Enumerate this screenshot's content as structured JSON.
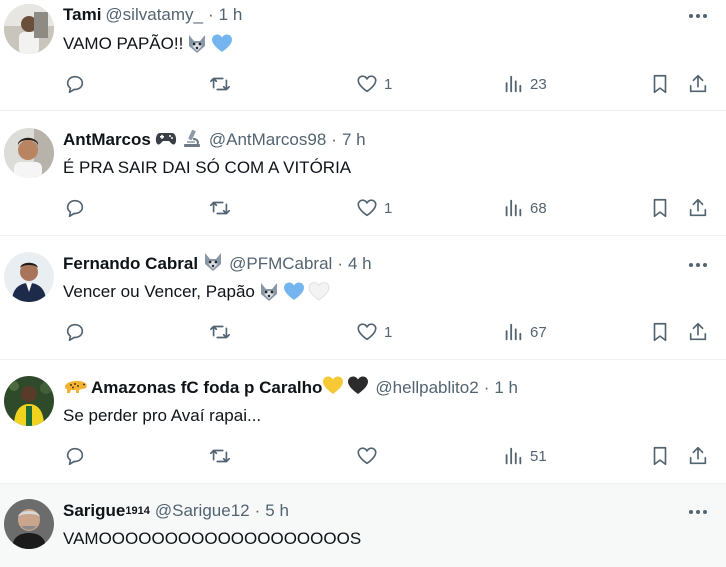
{
  "posts": [
    {
      "name": "Tami",
      "handle": "@silvatamy_",
      "separator": "·",
      "time": "1 h",
      "text": "VAMO PAPÃO!! ",
      "emojis": [
        "wolf-emoji",
        "blue-heart-emoji"
      ],
      "replies": "",
      "reposts": "",
      "likes": "1",
      "views": "23"
    },
    {
      "name": "AntMarcos",
      "name_badges": [
        "game-controller-emoji",
        "microscope-emoji"
      ],
      "handle": "@AntMarcos98",
      "separator": "·",
      "time": "7 h",
      "text": "É PRA SAIR DAI SÓ COM A VITÓRIA",
      "replies": "",
      "reposts": "",
      "likes": "1",
      "views": "68"
    },
    {
      "name": "Fernando Cabral",
      "name_badges": [
        "wolf-emoji"
      ],
      "handle": "@PFMCabral",
      "separator": "·",
      "time": "4 h",
      "text": "Vencer ou Vencer, Papão ",
      "emojis": [
        "wolf-emoji",
        "blue-heart-emoji",
        "white-heart-emoji"
      ],
      "replies": "",
      "reposts": "",
      "likes": "1",
      "views": "67"
    },
    {
      "name_prefix_emoji": "leopard-emoji",
      "name": "Amazonas fC foda p Caralho",
      "name_badges": [
        "yellow-heart-emoji",
        "black-heart-emoji"
      ],
      "handle": "@hellpablito2",
      "separator": "·",
      "time": "1 h",
      "text": "Se perder pro Avaí rapai...",
      "replies": "",
      "reposts": "",
      "likes": "",
      "views": "51"
    },
    {
      "name": "Sarigue",
      "name_sup": "1914",
      "handle": "@Sarigue12",
      "separator": "·",
      "time": "5 h",
      "text": "VAMOOOOOOOOOOOOOOOOOOOS"
    }
  ],
  "colors": {
    "text": "#0f1419",
    "secondary": "#536471",
    "divider": "#eff3f4",
    "blue_heart": "#74b4ef"
  }
}
